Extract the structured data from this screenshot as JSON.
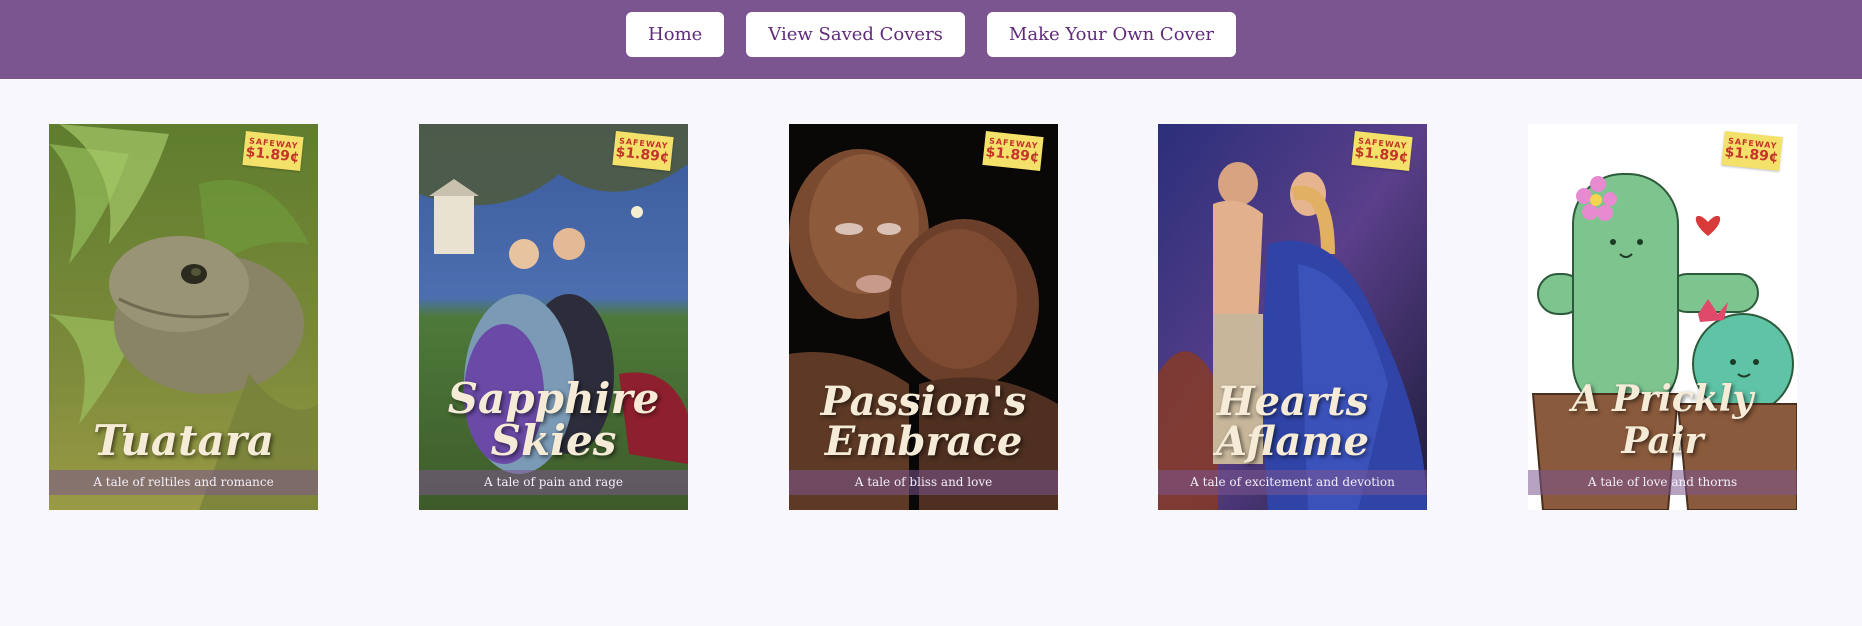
{
  "nav": {
    "home_label": "Home",
    "saved_label": "View Saved Covers",
    "make_label": "Make Your Own Cover"
  },
  "covers": [
    {
      "title": "Tuatara",
      "tagline": "A tale of reltiles and romance",
      "price_store": "SAFEWAY",
      "price": "$1.89¢",
      "theme": "tuatara-lizard"
    },
    {
      "title": "Sapphire Skies",
      "tagline": "A tale of pain and rage",
      "price_store": "SAFEWAY",
      "price": "$1.89¢",
      "theme": "victorian-couple"
    },
    {
      "title": "Passion's Embrace",
      "tagline": "A tale of bliss and love",
      "price_store": "SAFEWAY",
      "price": "$1.89¢",
      "theme": "embrace-portrait"
    },
    {
      "title": "Hearts Aflame",
      "tagline": "A tale of excitement and devotion",
      "price_store": "SAFEWAY",
      "price": "$1.89¢",
      "theme": "blue-gown-couple"
    },
    {
      "title": "A Prickly Pair",
      "tagline": "A tale of love and thorns",
      "price_store": "SAFEWAY",
      "price": "$1.89¢",
      "theme": "cactus-couple"
    }
  ],
  "colors": {
    "header": "#7b5590",
    "background": "#f8f7fb",
    "button_text": "#5f2b7a",
    "price_tag": "#f4e16a"
  }
}
